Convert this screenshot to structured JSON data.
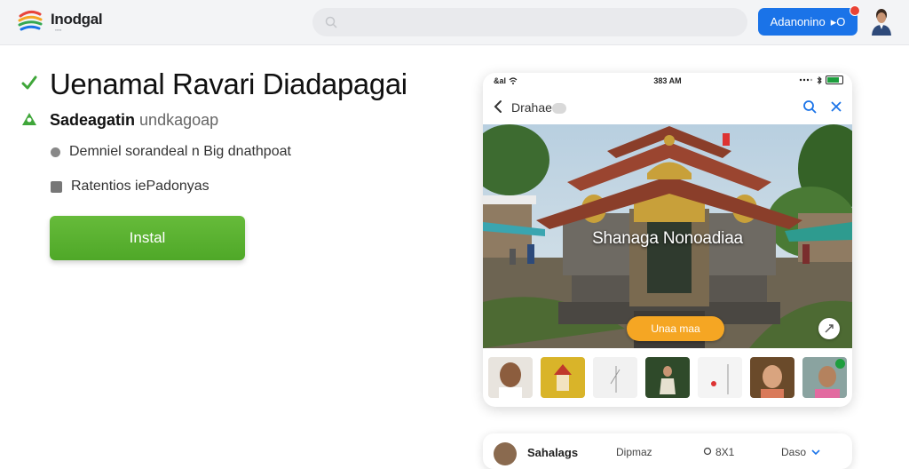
{
  "header": {
    "brand": "Inodgal",
    "brand_sub": "ꞏꞏꞏꞏ",
    "search_placeholder": "",
    "cta_label": "Adanonino",
    "cta_suffix": "▸O"
  },
  "main": {
    "headline": "Uenamal Ravari Diadapagai",
    "subtitle_strong": "Sadeagatin",
    "subtitle_soft": "undkagoap",
    "bullets": [
      "Demniel sorandeal n Big dnathpoat",
      "Ratentios iePadonyas"
    ],
    "install_label": "Instal"
  },
  "phone": {
    "status_time": "383 AM",
    "status_left": "&al",
    "nav_title": "Drahae",
    "hero_title": "Shanaga Nonoadiaa",
    "hero_button": "Unaa maa",
    "thumbnails": [
      "person",
      "shrine",
      "sketch",
      "dancer",
      "drawing",
      "woman",
      "child"
    ]
  },
  "lower_card": {
    "name": "Sahalags",
    "mid": "Dipmaz",
    "pin_label": "8X1",
    "right_label": "Daso"
  },
  "colors": {
    "accent_blue": "#1a73e8",
    "install_green": "#52ab2c",
    "hero_orange": "#f5a623",
    "badge_red": "#ea4335"
  }
}
